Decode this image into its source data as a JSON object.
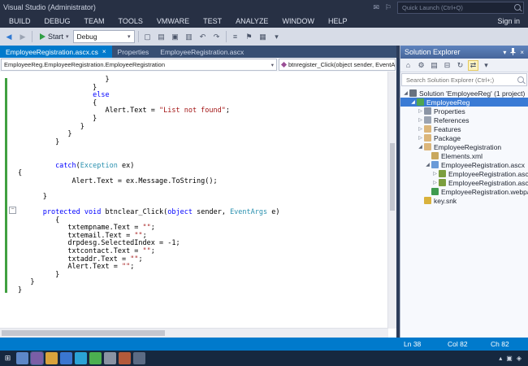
{
  "title_bar": {
    "title": "Visual Studio (Administrator)",
    "quick_launch_placeholder": "Quick Launch (Ctrl+Q)",
    "sign_in": "Sign in"
  },
  "menu": {
    "items": [
      "BUILD",
      "DEBUG",
      "TEAM",
      "TOOLS",
      "VMWARE",
      "TEST",
      "ANALYZE",
      "WINDOW",
      "HELP"
    ]
  },
  "toolbar": {
    "start_label": "Start",
    "debug_value": "Debug",
    "left_icons": [
      {
        "name": "navigate-back",
        "glyph": "◀",
        "color": "#2f78d2"
      },
      {
        "name": "navigate-forward",
        "glyph": "▶",
        "color": "#9aa3b2"
      }
    ],
    "mid_icons": [
      {
        "name": "new-project",
        "glyph": "▢"
      },
      {
        "name": "open-file",
        "glyph": "▤"
      },
      {
        "name": "save",
        "glyph": "▣"
      },
      {
        "name": "save-all",
        "glyph": "▥"
      },
      {
        "name": "undo",
        "glyph": "↶"
      },
      {
        "name": "redo",
        "glyph": "↷"
      }
    ],
    "right_icons": [
      {
        "name": "find-in-files",
        "glyph": "≡"
      },
      {
        "name": "bookmark",
        "glyph": "⚑"
      },
      {
        "name": "comment-lines",
        "glyph": "▦"
      },
      {
        "name": "toolbar-options",
        "glyph": "▾"
      }
    ]
  },
  "editor": {
    "tabs": [
      {
        "label": "EmployeeRegistration.ascx.cs",
        "active": true
      },
      {
        "label": "Properties",
        "active": false
      },
      {
        "label": "EmployeeRegistration.ascx",
        "active": false
      }
    ],
    "type_dropdown": "EmployeeReg.EmployeeRegistration.EmployeeRegistration",
    "member_dropdown": "btnregister_Click(object sender, EventArgs e)",
    "code_lines": [
      {
        "i": 21,
        "s": [
          [
            "p",
            "}"
          ]
        ]
      },
      {
        "i": 18,
        "s": [
          [
            "p",
            "}"
          ]
        ]
      },
      {
        "i": 18,
        "s": [
          [
            "k",
            "else"
          ]
        ]
      },
      {
        "i": 18,
        "s": [
          [
            "p",
            "{"
          ]
        ]
      },
      {
        "i": 21,
        "s": [
          [
            "p",
            "Alert.Text = "
          ],
          [
            "s",
            "\"List not found\""
          ],
          [
            "p",
            ";"
          ]
        ]
      },
      {
        "i": 18,
        "s": [
          [
            "p",
            "}"
          ]
        ]
      },
      {
        "i": 15,
        "s": [
          [
            "p",
            "}"
          ]
        ]
      },
      {
        "i": 12,
        "s": [
          [
            "p",
            "}"
          ]
        ]
      },
      {
        "i": 9,
        "s": [
          [
            "p",
            "}"
          ]
        ]
      },
      {
        "i": 0,
        "s": []
      },
      {
        "i": 0,
        "s": []
      },
      {
        "i": 9,
        "s": [
          [
            "k",
            "catch"
          ],
          [
            "p",
            "("
          ],
          [
            "t",
            "Exception"
          ],
          [
            "p",
            " ex)"
          ]
        ]
      },
      {
        "i": 0,
        "s": [
          [
            "p",
            "{"
          ]
        ]
      },
      {
        "i": 13,
        "s": [
          [
            "p",
            "Alert.Text = ex.Message.ToString();"
          ]
        ]
      },
      {
        "i": 0,
        "s": []
      },
      {
        "i": 6,
        "s": [
          [
            "p",
            "}"
          ]
        ]
      },
      {
        "i": 0,
        "s": []
      },
      {
        "i": 6,
        "s": [
          [
            "k",
            "protected"
          ],
          [
            "p",
            " "
          ],
          [
            "k",
            "void"
          ],
          [
            "p",
            " btnclear_Click("
          ],
          [
            "k",
            "object"
          ],
          [
            "p",
            " sender, "
          ],
          [
            "t",
            "EventArgs"
          ],
          [
            "p",
            " e)"
          ]
        ]
      },
      {
        "i": 9,
        "s": [
          [
            "p",
            "{"
          ]
        ]
      },
      {
        "i": 12,
        "s": [
          [
            "p",
            "txtempname.Text = "
          ],
          [
            "s",
            "\"\""
          ],
          [
            "p",
            ";"
          ]
        ]
      },
      {
        "i": 12,
        "s": [
          [
            "p",
            "txtemail.Text = "
          ],
          [
            "s",
            "\"\""
          ],
          [
            "p",
            ";"
          ]
        ]
      },
      {
        "i": 12,
        "s": [
          [
            "p",
            "drpdesg.SelectedIndex = -1;"
          ]
        ]
      },
      {
        "i": 12,
        "s": [
          [
            "p",
            "txtcontact.Text = "
          ],
          [
            "s",
            "\"\""
          ],
          [
            "p",
            ";"
          ]
        ]
      },
      {
        "i": 12,
        "s": [
          [
            "p",
            "txtaddr.Text = "
          ],
          [
            "s",
            "\"\""
          ],
          [
            "p",
            ";"
          ]
        ]
      },
      {
        "i": 12,
        "s": [
          [
            "p",
            "Alert.Text = "
          ],
          [
            "s",
            "\"\""
          ],
          [
            "p",
            ";"
          ]
        ]
      },
      {
        "i": 9,
        "s": [
          [
            "p",
            "}"
          ]
        ]
      },
      {
        "i": 3,
        "s": [
          [
            "p",
            "}"
          ]
        ]
      },
      {
        "i": 0,
        "s": [
          [
            "p",
            "}"
          ]
        ]
      }
    ]
  },
  "solution_explorer": {
    "title": "Solution Explorer",
    "search_placeholder": "Search Solution Explorer (Ctrl+;)",
    "toolbar_icons": [
      {
        "name": "home",
        "glyph": "⌂"
      },
      {
        "name": "properties-tool",
        "glyph": "⚙"
      },
      {
        "name": "show-all-files",
        "glyph": "▤"
      },
      {
        "name": "collapse-all",
        "glyph": "⊟"
      },
      {
        "name": "refresh",
        "glyph": "↻"
      },
      {
        "name": "sync-with-active-document",
        "glyph": "⇄",
        "highlight": true
      },
      {
        "name": "more-options",
        "glyph": "▾"
      }
    ],
    "tree": [
      {
        "label": "Solution 'EmployeeReg' (1 project)",
        "level": 0,
        "expander": "expanded",
        "icon": "solution",
        "selected": false
      },
      {
        "label": "EmployeeReg",
        "level": 1,
        "expander": "expanded",
        "icon": "project",
        "selected": true
      },
      {
        "label": "Properties",
        "level": 2,
        "expander": "collapsed",
        "icon": "properties",
        "selected": false
      },
      {
        "label": "References",
        "level": 2,
        "expander": "collapsed",
        "icon": "references",
        "selected": false
      },
      {
        "label": "Features",
        "level": 2,
        "expander": "collapsed",
        "icon": "folder",
        "selected": false
      },
      {
        "label": "Package",
        "level": 2,
        "expander": "collapsed",
        "icon": "folder",
        "selected": false
      },
      {
        "label": "EmployeeRegistration",
        "level": 2,
        "expander": "expanded",
        "icon": "folder",
        "selected": false
      },
      {
        "label": "Elements.xml",
        "level": 3,
        "expander": "none",
        "icon": "xml",
        "selected": false
      },
      {
        "label": "EmployeeRegistration.ascx",
        "level": 3,
        "expander": "expanded",
        "icon": "ascx",
        "selected": false
      },
      {
        "label": "EmployeeRegistration.ascx.cs",
        "level": 4,
        "expander": "collapsed",
        "icon": "cs",
        "selected": false
      },
      {
        "label": "EmployeeRegistration.ascx.g.cs",
        "level": 4,
        "expander": "collapsed",
        "icon": "cs",
        "selected": false
      },
      {
        "label": "EmployeeRegistration.webpart",
        "level": 3,
        "expander": "none",
        "icon": "webpart",
        "selected": false
      },
      {
        "label": "key.snk",
        "level": 2,
        "expander": "none",
        "icon": "key",
        "selected": false
      }
    ]
  },
  "status_bar": {
    "line": "Ln 38",
    "column": "Col 82",
    "character": "Ch 82"
  },
  "taskbar": {
    "icons": [
      {
        "name": "windows-start-icon",
        "glyph": "⊞",
        "color": "transparent"
      },
      {
        "name": "taskbar-app-icon-1",
        "color": "#5d87c7"
      },
      {
        "name": "taskbar-app-icon-2",
        "color": "#7a5ea6",
        "active": true
      },
      {
        "name": "taskbar-app-icon-3",
        "color": "#d9a33c"
      },
      {
        "name": "taskbar-app-icon-4",
        "color": "#3a76d0"
      },
      {
        "name": "taskbar-app-icon-5",
        "color": "#2aa3d6"
      },
      {
        "name": "taskbar-app-icon-6",
        "color": "#4caf50"
      },
      {
        "name": "taskbar-app-icon-7",
        "color": "#8a93a3"
      },
      {
        "name": "taskbar-app-icon-8",
        "color": "#b35a3a"
      },
      {
        "name": "taskbar-app-icon-9",
        "color": "#5b6b84"
      }
    ],
    "tray": [
      {
        "name": "tray-expand-icon",
        "glyph": "▴"
      },
      {
        "name": "network-icon",
        "glyph": "▣"
      },
      {
        "name": "volume-icon",
        "glyph": "◈"
      }
    ]
  },
  "colors": {
    "accent": "#007acc",
    "selection": "#3a7bd5",
    "keyword": "#0000ff",
    "string": "#a31515",
    "type": "#2b91af",
    "change_bar": "#40a040"
  }
}
